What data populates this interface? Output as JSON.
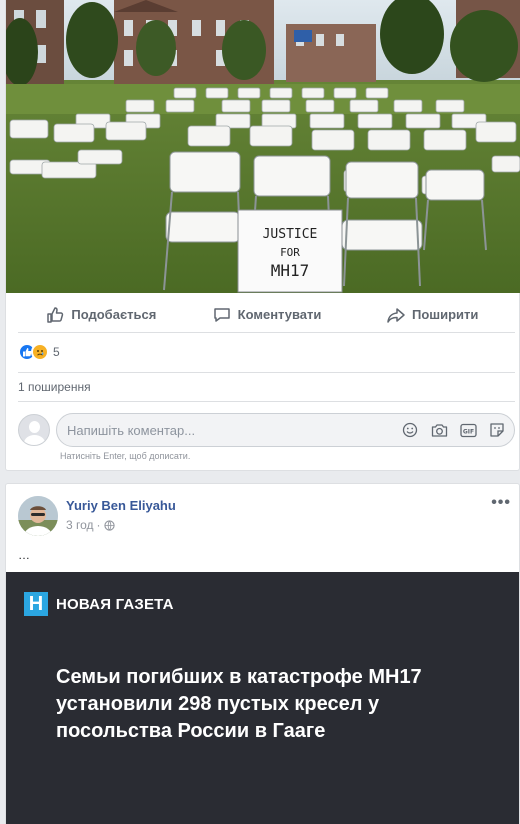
{
  "post1": {
    "photo": {
      "sign_line1": "JUSTICE",
      "sign_line2": "FOR",
      "sign_line3": "MH17"
    },
    "actions": {
      "like_label": "Подобається",
      "comment_label": "Коментувати",
      "share_label": "Поширити"
    },
    "reactions": {
      "types": [
        "like-icon",
        "sad-icon"
      ],
      "count": "5"
    },
    "shares_text": "1 поширення",
    "comment_input": {
      "placeholder": "Напишіть коментар...",
      "value": ""
    },
    "comment_hint": "Натисніть Enter, щоб дописати.",
    "colors": {
      "accent": "#1877f2",
      "link": "#385898"
    }
  },
  "post2": {
    "author": "Yuriy Ben Eliyahu",
    "time": "3 год",
    "separator": "·",
    "text": "…",
    "more_label": "•••",
    "article": {
      "publisher": "НОВАЯ ГАЗЕТА",
      "logo_letter": "Н",
      "headline": "Семьи погибших в катастрофе MH17 установили 298 пустых кресел у посольства России в Гааге",
      "logo_color": "#2ba6e1"
    }
  }
}
